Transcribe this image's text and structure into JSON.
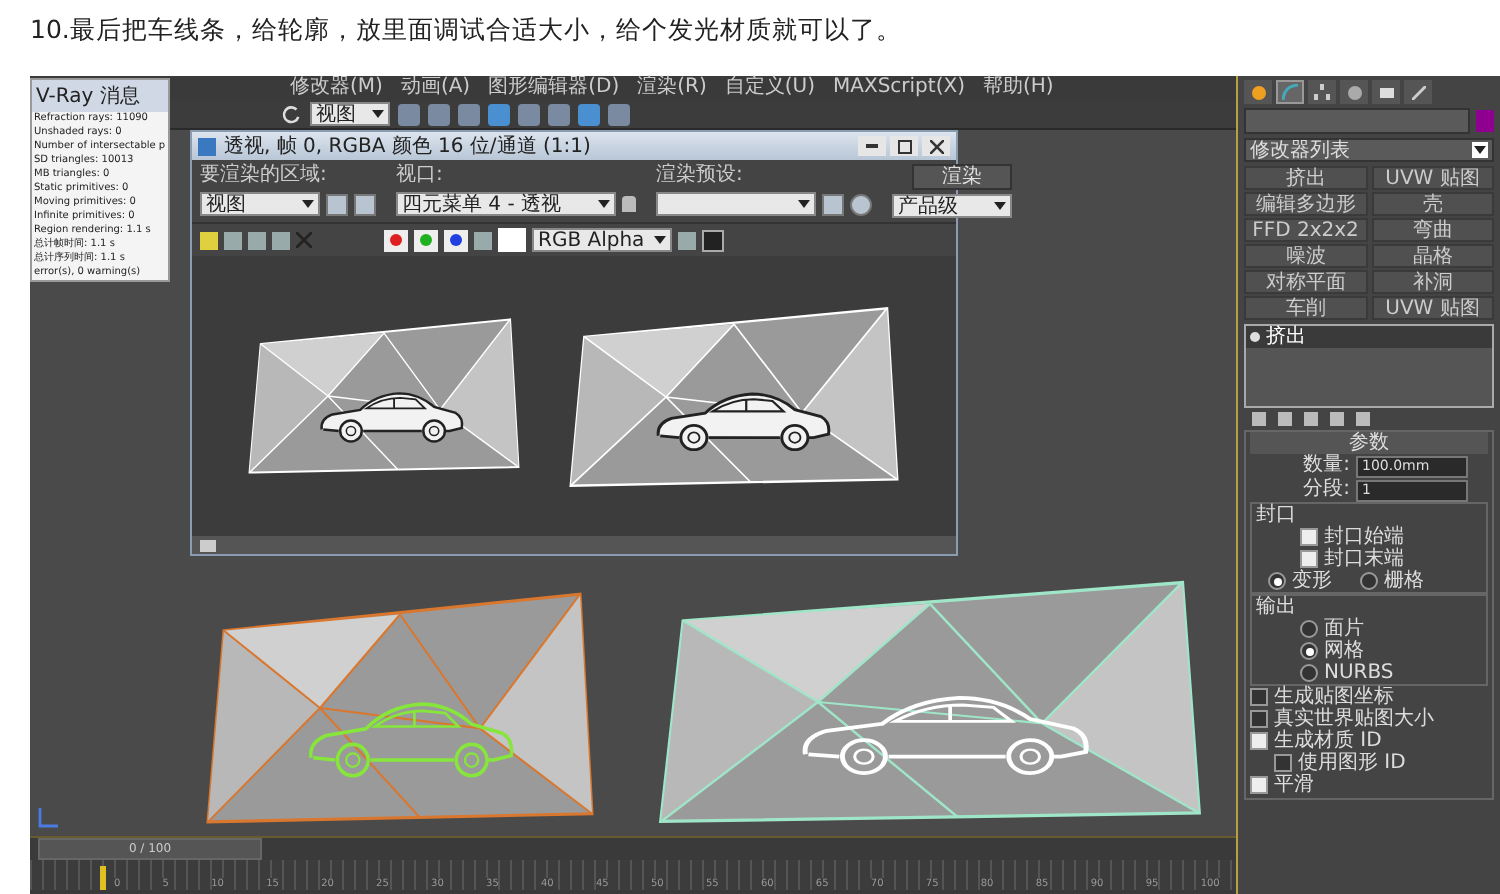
{
  "caption": "10.最后把车线条，给轮廓，放里面调试合适大小，给个发光材质就可以了。",
  "menu": [
    "修改器(M)",
    "动画(A)",
    "图形编辑器(D)",
    "渲染(R)",
    "自定义(U)",
    "MAXScript(X)",
    "帮助(H)"
  ],
  "toolbar": {
    "view_dropdown": "视图"
  },
  "vray_window": {
    "title": "V-Ray 消息",
    "lines": [
      "Refraction rays: 11090",
      "Unshaded rays: 0",
      "Number of intersectable p",
      "SD triangles: 10013",
      "MB triangles: 0",
      "Static primitives: 0",
      "Moving primitives: 0",
      "Infinite primitives: 0",
      "Region rendering: 1.1 s",
      "总计帧时间: 1.1 s",
      "总计序列时间: 1.1 s",
      "error(s), 0 warning(s)"
    ]
  },
  "render_window": {
    "title": "透视, 帧 0, RGBA 颜色 16 位/通道 (1:1)",
    "area_label": "要渲染的区域:",
    "area_value": "视图",
    "viewport_label": "视口:",
    "viewport_value": "四元菜单 4 - 透视",
    "preset_label": "渲染预设:",
    "render_button": "渲染",
    "quality_value": "产品级",
    "channel_value": "RGB Alpha"
  },
  "viewport_objects": [
    {
      "color": "#d9772e",
      "car": {
        "color": "#86e63c"
      }
    },
    {
      "color": "#9fe6c8",
      "car": {
        "color": "#ffffff"
      }
    }
  ],
  "command_panel": {
    "modifier_list": "修改器列表",
    "modifier_buttons": [
      "挤出",
      "UVW 贴图",
      "编辑多边形",
      "壳",
      "FFD 2x2x2",
      "弯曲",
      "噪波",
      "晶格",
      "对称平面",
      "补洞",
      "车削",
      "UVW 贴图"
    ],
    "stack": [
      {
        "label": "挤出",
        "selected": true
      }
    ],
    "rollout": "参数",
    "fields": [
      {
        "label": "数量:",
        "value": "100.0mm"
      },
      {
        "label": "分段:",
        "value": "1"
      }
    ],
    "cap_group": "封口",
    "caps": [
      {
        "label": "封口始端",
        "checked": true
      },
      {
        "label": "封口末端",
        "checked": true
      }
    ],
    "cap_types": [
      {
        "label": "变形",
        "selected": true
      },
      {
        "label": "栅格",
        "selected": false
      }
    ],
    "output_group": "输出",
    "outputs": [
      {
        "label": "面片",
        "selected": false
      },
      {
        "label": "网格",
        "selected": true
      },
      {
        "label": "NURBS",
        "selected": false
      }
    ],
    "options": [
      {
        "label": "生成贴图坐标",
        "checked": false,
        "indent": false
      },
      {
        "label": "真实世界贴图大小",
        "checked": false,
        "indent": false
      },
      {
        "label": "生成材质 ID",
        "checked": true,
        "indent": false
      },
      {
        "label": "使用图形 ID",
        "checked": false,
        "indent": true
      },
      {
        "label": "平滑",
        "checked": true,
        "indent": false
      }
    ]
  },
  "timeline": {
    "position": "0 / 100",
    "ticks": [
      "0",
      "5",
      "10",
      "15",
      "20",
      "25",
      "30",
      "35",
      "40",
      "45",
      "50",
      "55",
      "60",
      "65",
      "70",
      "75",
      "80",
      "85",
      "90",
      "95",
      "100"
    ]
  }
}
